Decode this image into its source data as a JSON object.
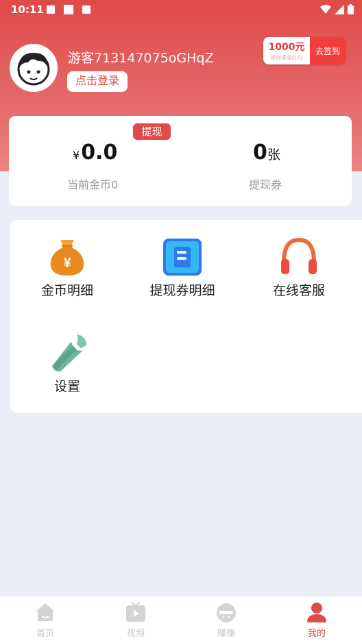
{
  "status": {
    "time": "10:11"
  },
  "user": {
    "name": "游客713147075oGHqZ",
    "login_label": "点击登录"
  },
  "signin": {
    "amount": "1000元",
    "subtitle": "等你来拿红包",
    "button": "去签到"
  },
  "wallet": {
    "withdraw_label": "提现",
    "currency": "¥",
    "coin_amount": "0.0",
    "coin_label": "当前金币0",
    "ticket_amount": "0",
    "ticket_unit": "张",
    "ticket_label": "提现券"
  },
  "menu": {
    "items": [
      {
        "label": "金币明细",
        "icon": "money-bag-icon"
      },
      {
        "label": "提现券明细",
        "icon": "ticket-icon"
      },
      {
        "label": "在线客服",
        "icon": "headphones-icon"
      },
      {
        "label": "设置",
        "icon": "wrench-icon"
      }
    ]
  },
  "tabbar": {
    "tabs": [
      {
        "label": "首页",
        "icon": "home-icon"
      },
      {
        "label": "视频",
        "icon": "video-icon"
      },
      {
        "label": "赚赚",
        "icon": "earn-icon"
      },
      {
        "label": "我的",
        "icon": "profile-icon",
        "active": true
      }
    ]
  },
  "colors": {
    "primary": "#e04a48",
    "background": "#ebeef7"
  }
}
